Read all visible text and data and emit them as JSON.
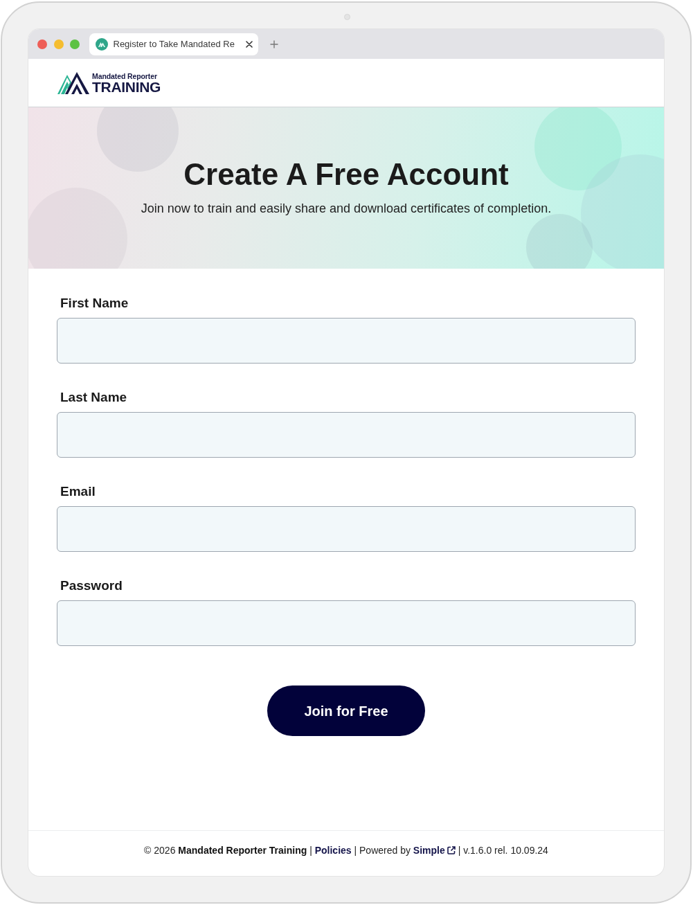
{
  "browser": {
    "tabs": [
      {
        "title": "Register to Take Mandated Re",
        "selected": true
      }
    ]
  },
  "logo": {
    "tagline": "Mandated Reporter",
    "wordmark": "TRAINING"
  },
  "hero": {
    "title": "Create A Free Account",
    "subtitle": "Join now to train and easily share and download certificates of completion."
  },
  "form": {
    "fields": [
      {
        "label": "First Name"
      },
      {
        "label": "Last Name"
      },
      {
        "label": "Email"
      },
      {
        "label": "Password"
      }
    ],
    "submit": "Join for Free"
  },
  "footer": {
    "parts": [
      {
        "kind": "text",
        "text": "© 2026 **Mandated Reporter Training** |"
      },
      {
        "kind": "link",
        "text": "Policies"
      },
      {
        "kind": "text",
        "text": "| Powered by"
      },
      {
        "kind": "external-link",
        "text": "Simple"
      },
      {
        "kind": "text",
        "text": "| v.1.6.0 rel. 10.09.24"
      }
    ]
  }
}
